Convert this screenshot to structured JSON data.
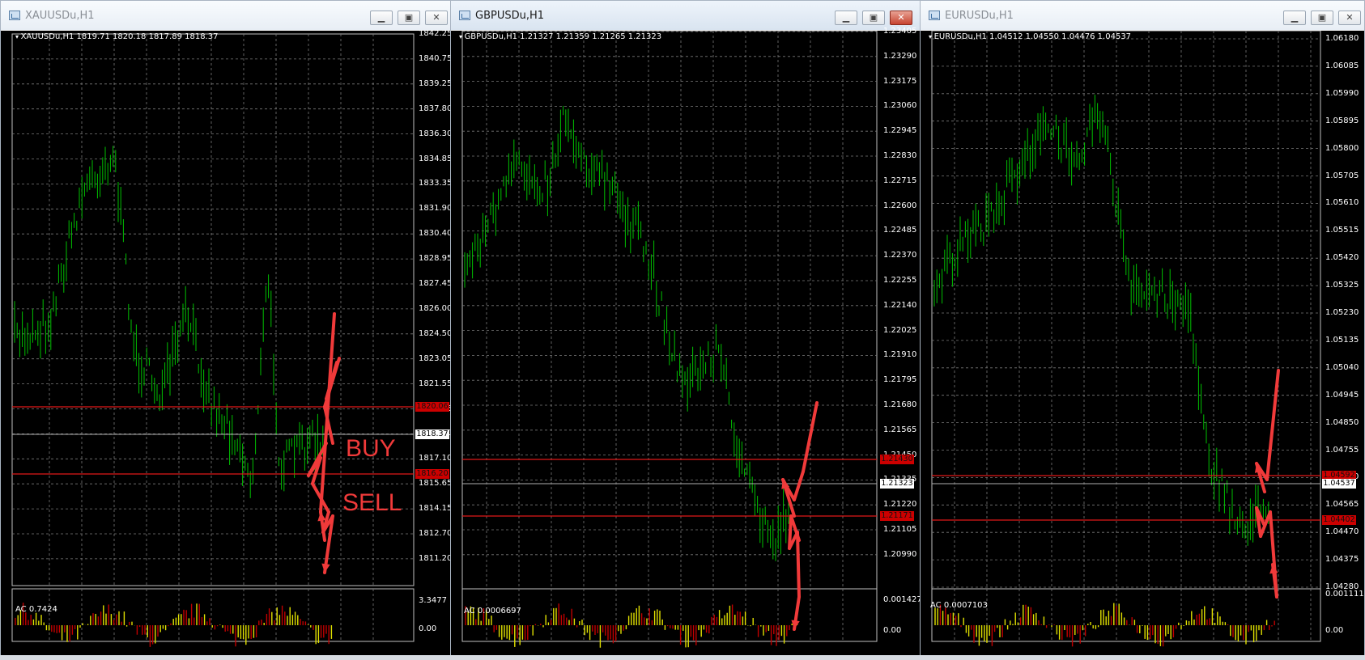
{
  "windows": [
    {
      "id": "xau",
      "title": "XAUUSDu,H1",
      "header": "XAUUSDu,H1  1819.71 1820.18 1817.89 1818.37",
      "active": false,
      "price_ticks": [
        "1842.25",
        "1840.75",
        "1839.25",
        "1837.80",
        "1836.30",
        "1834.85",
        "1833.35",
        "1831.90",
        "1830.40",
        "1828.95",
        "1827.45",
        "1826.00",
        "1824.50",
        "1823.05",
        "1821.55",
        "1820.05",
        "1818.60",
        "1817.10",
        "1815.65",
        "1814.15",
        "1812.70",
        "1811.20"
      ],
      "price_boxes": [
        {
          "label": "1820.06",
          "color": "#cc0000",
          "text": "#111111"
        },
        {
          "label": "1818.37",
          "color": "#ffffff",
          "text": "#000000"
        },
        {
          "label": "1816.20",
          "color": "#cc0000",
          "text": "#111111"
        }
      ],
      "indicator": {
        "label": "AC 0.7424",
        "ticks": [
          "3.3477",
          "0.00"
        ]
      },
      "annotations": [
        "BUY",
        "SELL"
      ],
      "window_buttons": [
        "minimize",
        "maximize",
        "close"
      ]
    },
    {
      "id": "gbp",
      "title": "GBPUSDu,H1",
      "header": "GBPUSDu,H1  1.21327 1.21359 1.21265 1.21323",
      "active": true,
      "price_ticks": [
        "1.23405",
        "1.23290",
        "1.23175",
        "1.23060",
        "1.22945",
        "1.22830",
        "1.22715",
        "1.22600",
        "1.22485",
        "1.22370",
        "1.22255",
        "1.22140",
        "1.22025",
        "1.21910",
        "1.21795",
        "1.21680",
        "1.21565",
        "1.21450",
        "1.21335",
        "1.21220",
        "1.21105",
        "1.20990"
      ],
      "price_boxes": [
        {
          "label": "1.21430",
          "color": "#cc0000",
          "text": "#111111"
        },
        {
          "label": "1.21323",
          "color": "#ffffff",
          "text": "#000000"
        },
        {
          "label": "1.21171",
          "color": "#cc0000",
          "text": "#111111"
        }
      ],
      "indicator": {
        "label": "AC 0.0006697",
        "ticks": [
          "0.0014273",
          "0.00"
        ]
      },
      "annotations": [],
      "window_buttons": [
        "minimize",
        "maximize",
        "close"
      ]
    },
    {
      "id": "eur",
      "title": "EURUSDu,H1",
      "header": "EURUSDu,H1  1.04512 1.04550 1.04476 1.04537",
      "active": false,
      "price_ticks": [
        "1.06180",
        "1.06085",
        "1.05990",
        "1.05895",
        "1.05800",
        "1.05705",
        "1.05610",
        "1.05515",
        "1.05420",
        "1.05325",
        "1.05230",
        "1.05135",
        "1.05040",
        "1.04945",
        "1.04850",
        "1.04755",
        "1.04660",
        "1.04565",
        "1.04470",
        "1.04375",
        "1.04280"
      ],
      "price_boxes": [
        {
          "label": "1.04592",
          "color": "#cc0000",
          "text": "#111111"
        },
        {
          "label": "1.04537",
          "color": "#ffffff",
          "text": "#000000"
        },
        {
          "label": "1.04402",
          "color": "#cc0000",
          "text": "#111111"
        }
      ],
      "indicator": {
        "label": "AC 0.0007103",
        "ticks": [
          "0.0011118",
          "0.00"
        ]
      },
      "annotations": [],
      "window_buttons": [
        "minimize",
        "maximize",
        "close"
      ]
    }
  ],
  "colors": {
    "background": "#000000",
    "candles": "#00c000",
    "grid": "#7a7a7a",
    "level_line": "#e01818",
    "current_line": "#b0b0b0",
    "arrows": "#f03a3a",
    "ac_up": "#e0e000",
    "ac_down": "#c00000"
  }
}
